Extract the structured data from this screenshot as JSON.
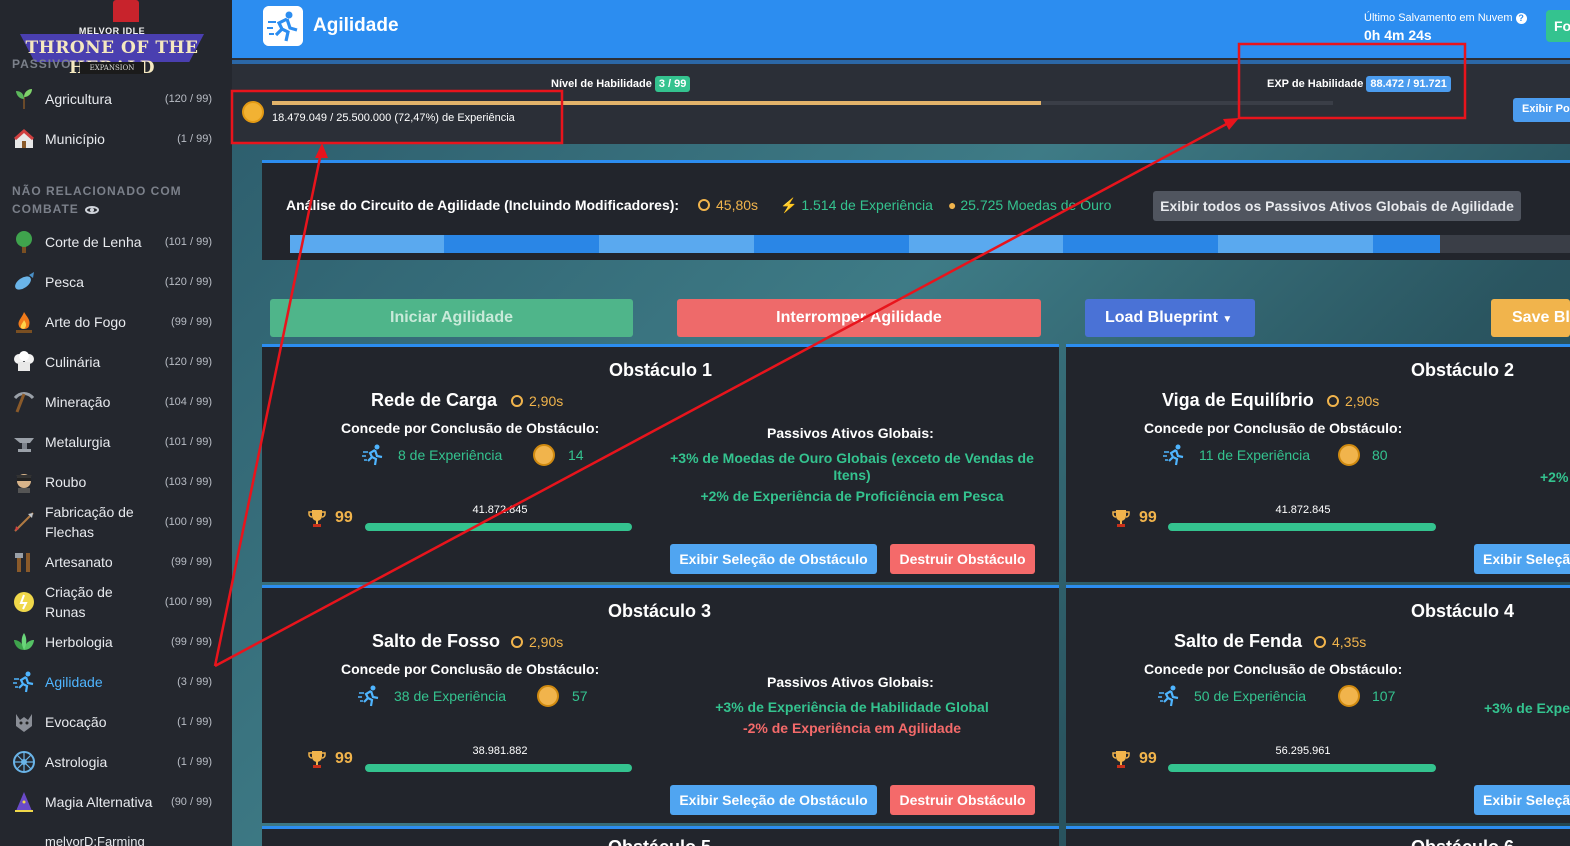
{
  "logo": {
    "small": "MELVOR IDLE",
    "title": "THRONE OF THE HERALD",
    "expansion": "EXPANSION"
  },
  "sidebar": {
    "passive_header": "PASSIVO",
    "passive_items": [
      {
        "label": "Agricultura",
        "level": "(120 / 99)",
        "icon": "farming-icon"
      },
      {
        "label": "Município",
        "level": "(1 / 99)",
        "icon": "township-icon"
      }
    ],
    "noncombat_header": "NÃO RELACIONADO COM COMBATE",
    "items": [
      {
        "label": "Corte de Lenha",
        "level": "(101 / 99)",
        "icon": "woodcutting-icon"
      },
      {
        "label": "Pesca",
        "level": "(120 / 99)",
        "icon": "fishing-icon"
      },
      {
        "label": "Arte do Fogo",
        "level": "(99 / 99)",
        "icon": "firemaking-icon"
      },
      {
        "label": "Culinária",
        "level": "(120 / 99)",
        "icon": "cooking-icon"
      },
      {
        "label": "Mineração",
        "level": "(104 / 99)",
        "icon": "mining-icon"
      },
      {
        "label": "Metalurgia",
        "level": "(101 / 99)",
        "icon": "smithing-icon"
      },
      {
        "label": "Roubo",
        "level": "(103 / 99)",
        "icon": "thieving-icon"
      },
      {
        "label": "Fabricação de Flechas",
        "level": "(100 / 99)",
        "icon": "fletching-icon"
      },
      {
        "label": "Artesanato",
        "level": "(99 / 99)",
        "icon": "crafting-icon"
      },
      {
        "label": "Criação de Runas",
        "level": "(100 / 99)",
        "icon": "runecrafting-icon"
      },
      {
        "label": "Herbologia",
        "level": "(99 / 99)",
        "icon": "herblore-icon"
      },
      {
        "label": "Agilidade",
        "level": "(3 / 99)",
        "icon": "agility-icon"
      },
      {
        "label": "Evocação",
        "level": "(1 / 99)",
        "icon": "summoning-icon"
      },
      {
        "label": "Astrologia",
        "level": "(1 / 99)",
        "icon": "astrology-icon"
      },
      {
        "label": "Magia Alternativa",
        "level": "(90 / 99)",
        "icon": "alt-magic-icon"
      },
      {
        "label": "melvorD:Farming",
        "level": "",
        "icon": ""
      }
    ]
  },
  "header": {
    "title": "Agilidade",
    "save_label": "Último Salvamento em Nuvem",
    "save_time": "0h 4m 24s",
    "fo_button": "Fo",
    "color": "#2c8df0"
  },
  "skill_progress": {
    "level_label": "Nível de Habilidade",
    "level_value": "3 / 99",
    "exp_label": "EXP de Habilidade",
    "exp_value": "88.472 / 91.721",
    "mastery_text": "18.479.049 / 25.500.000 (72,47%) de Experiência",
    "mastery_percent": 72.47,
    "exibir_button": "Exibir Po"
  },
  "circuit": {
    "label": "Análise do Circuito de Agilidade (Incluindo Modificadores):",
    "time": "45,80s",
    "xp": "1.514 de Experiência",
    "gold": "25.725 Moedas de Ouro",
    "show_all_button": "Exibir todos os Passivos Ativos Globais de Agilidade"
  },
  "actions": {
    "start": "Iniciar Agilidade",
    "stop": "Interromper Agilidade",
    "load": "Load Blueprint",
    "save": "Save Bl"
  },
  "obstacles": [
    {
      "title": "Obstáculo 1",
      "name": "Rede de Carga",
      "time": "2,90s",
      "grants": "Concede por Conclusão de Obstáculo:",
      "xp": "8 de Experiência",
      "gold": "14",
      "passives_header": "Passivos Ativos Globais:",
      "passive_pos_1": "+3% de Moedas de Ouro Globais (exceto de Vendas de Itens)",
      "passive_pos_2": "+2% de Experiência de Proficiência em Pesca",
      "mastery_level": "99",
      "mastery_xp": "41.872.845",
      "select_button": "Exibir Seleção de Obstáculo",
      "destroy_button": "Destruir Obstáculo"
    },
    {
      "title": "Obstáculo 2",
      "name": "Viga de Equilíbrio",
      "time": "2,90s",
      "grants": "Concede por Conclusão de Obstáculo:",
      "xp": "11 de Experiência",
      "gold": "80",
      "passive_partial": "+2%",
      "mastery_level": "99",
      "mastery_xp": "41.872.845",
      "select_button": "Exibir Seleçã"
    },
    {
      "title": "Obstáculo 3",
      "name": "Salto de Fosso",
      "time": "2,90s",
      "grants": "Concede por Conclusão de Obstáculo:",
      "xp": "38 de Experiência",
      "gold": "57",
      "passives_header": "Passivos Ativos Globais:",
      "passive_pos_1": "+3% de Experiência de Habilidade Global",
      "passive_neg_1": "-2% de Experiência em Agilidade",
      "mastery_level": "99",
      "mastery_xp": "38.981.882",
      "select_button": "Exibir Seleção de Obstáculo",
      "destroy_button": "Destruir Obstáculo"
    },
    {
      "title": "Obstáculo 4",
      "name": "Salto de Fenda",
      "time": "4,35s",
      "grants": "Concede por Conclusão de Obstáculo:",
      "xp": "50 de Experiência",
      "gold": "107",
      "passive_partial": "+3% de Expe",
      "mastery_level": "99",
      "mastery_xp": "56.295.961",
      "select_button": "Exibir Seleçã"
    }
  ],
  "next_obstacles": [
    "Obstáculo 5",
    "Obstáculo 6"
  ],
  "colors": {
    "accent": "#2c8df0",
    "green": "#34c38f",
    "red": "#f46a6a",
    "gold": "#f1b44c",
    "panel": "#22252c",
    "annotation": "#e8141c"
  }
}
